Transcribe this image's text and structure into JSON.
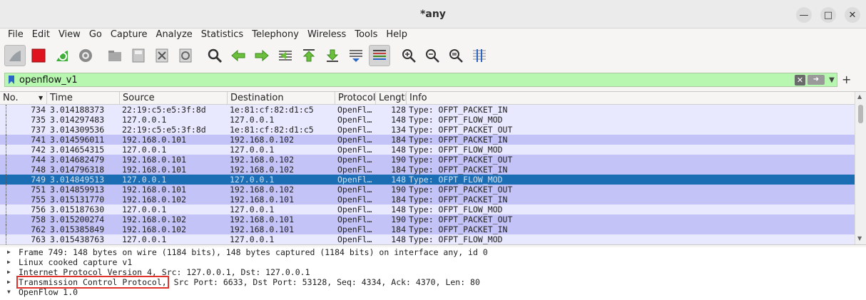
{
  "window": {
    "title": "*any"
  },
  "menu": [
    "File",
    "Edit",
    "View",
    "Go",
    "Capture",
    "Analyze",
    "Statistics",
    "Telephony",
    "Wireless",
    "Tools",
    "Help"
  ],
  "toolbar": {
    "buttons": [
      "shark-fin-icon",
      "stop-icon",
      "restart-icon",
      "options-gear-icon",
      "open-folder-icon",
      "save-icon",
      "close-file-icon",
      "reload-icon",
      "search-icon",
      "back-arrow-icon",
      "forward-arrow-icon",
      "go-to-packet-icon",
      "first-packet-icon",
      "last-packet-icon",
      "autoscroll-icon",
      "colorize-icon",
      "zoom-in-icon",
      "zoom-out-icon",
      "zoom-normal-icon",
      "resize-columns-icon"
    ]
  },
  "filter": {
    "value": "openflow_v1"
  },
  "packet_list": {
    "columns": [
      "No.",
      "Time",
      "Source",
      "Destination",
      "Protocol",
      "Length",
      "Info"
    ],
    "rows": [
      {
        "no": "734",
        "time": "3.014188373",
        "src": "22:19:c5:e5:3f:8d",
        "dst": "1e:81:cf:82:d1:c5",
        "proto": "OpenFl…",
        "len": "128",
        "info": "Type: OFPT_PACKET_IN",
        "style": "flow"
      },
      {
        "no": "735",
        "time": "3.014297483",
        "src": "127.0.0.1",
        "dst": "127.0.0.1",
        "proto": "OpenFl…",
        "len": "148",
        "info": "Type: OFPT_FLOW_MOD",
        "style": "flow"
      },
      {
        "no": "737",
        "time": "3.014309536",
        "src": "22:19:c5:e5:3f:8d",
        "dst": "1e:81:cf:82:d1:c5",
        "proto": "OpenFl…",
        "len": "134",
        "info": "Type: OFPT_PACKET_OUT",
        "style": "flow"
      },
      {
        "no": "741",
        "time": "3.014596011",
        "src": "192.168.0.101",
        "dst": "192.168.0.102",
        "proto": "OpenFl…",
        "len": "184",
        "info": "Type: OFPT_PACKET_IN",
        "style": "blue"
      },
      {
        "no": "742",
        "time": "3.014654315",
        "src": "127.0.0.1",
        "dst": "127.0.0.1",
        "proto": "OpenFl…",
        "len": "148",
        "info": "Type: OFPT_FLOW_MOD",
        "style": "flow"
      },
      {
        "no": "744",
        "time": "3.014682479",
        "src": "192.168.0.101",
        "dst": "192.168.0.102",
        "proto": "OpenFl…",
        "len": "190",
        "info": "Type: OFPT_PACKET_OUT",
        "style": "blue"
      },
      {
        "no": "748",
        "time": "3.014796318",
        "src": "192.168.0.101",
        "dst": "192.168.0.102",
        "proto": "OpenFl…",
        "len": "184",
        "info": "Type: OFPT_PACKET_IN",
        "style": "blue"
      },
      {
        "no": "749",
        "time": "3.014849513",
        "src": "127.0.0.1",
        "dst": "127.0.0.1",
        "proto": "OpenFl…",
        "len": "148",
        "info": "Type: OFPT_FLOW_MOD",
        "style": "selected"
      },
      {
        "no": "751",
        "time": "3.014859913",
        "src": "192.168.0.101",
        "dst": "192.168.0.102",
        "proto": "OpenFl…",
        "len": "190",
        "info": "Type: OFPT_PACKET_OUT",
        "style": "blue"
      },
      {
        "no": "755",
        "time": "3.015131770",
        "src": "192.168.0.102",
        "dst": "192.168.0.101",
        "proto": "OpenFl…",
        "len": "184",
        "info": "Type: OFPT_PACKET_IN",
        "style": "blue"
      },
      {
        "no": "756",
        "time": "3.015187630",
        "src": "127.0.0.1",
        "dst": "127.0.0.1",
        "proto": "OpenFl…",
        "len": "148",
        "info": "Type: OFPT_FLOW_MOD",
        "style": "flow"
      },
      {
        "no": "758",
        "time": "3.015200274",
        "src": "192.168.0.102",
        "dst": "192.168.0.101",
        "proto": "OpenFl…",
        "len": "190",
        "info": "Type: OFPT_PACKET_OUT",
        "style": "blue"
      },
      {
        "no": "762",
        "time": "3.015385849",
        "src": "192.168.0.102",
        "dst": "192.168.0.101",
        "proto": "OpenFl…",
        "len": "184",
        "info": "Type: OFPT_PACKET_IN",
        "style": "blue"
      },
      {
        "no": "763",
        "time": "3.015438763",
        "src": "127.0.0.1",
        "dst": "127.0.0.1",
        "proto": "OpenFl…",
        "len": "148",
        "info": "Type: OFPT_FLOW_MOD",
        "style": "flow"
      }
    ]
  },
  "details": {
    "frame": "Frame 749: 148 bytes on wire (1184 bits), 148 bytes captured (1184 bits) on interface any, id 0",
    "linux": "Linux cooked capture v1",
    "ip": "Internet Protocol Version 4, Src: 127.0.0.1, Dst: 127.0.0.1",
    "tcp_label": "Transmission Control Protocol,",
    "tcp_rest": " Src Port: 6633, Dst Port: 53128, Seq: 4334, Ack: 4370, Len: 80",
    "openflow": "OpenFlow 1.0"
  }
}
